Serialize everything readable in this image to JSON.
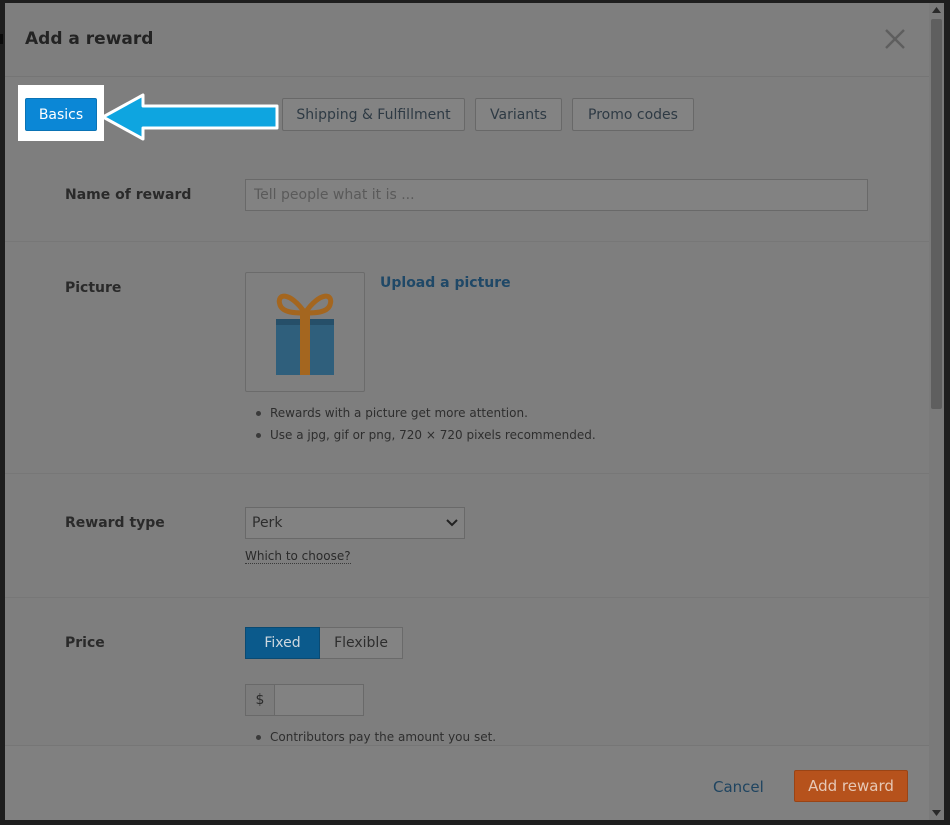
{
  "dialog": {
    "title": "Add a reward"
  },
  "tabs": [
    {
      "label": "Basics",
      "active": true
    },
    {
      "label": "Shipping & Fulfillment",
      "active": false
    },
    {
      "label": "Variants",
      "active": false
    },
    {
      "label": "Promo codes",
      "active": false
    }
  ],
  "form": {
    "name": {
      "label": "Name of reward",
      "placeholder": "Tell people what it is ...",
      "value": ""
    },
    "picture": {
      "label": "Picture",
      "upload_link": "Upload a picture",
      "icon": "gift-icon",
      "tips": [
        "Rewards with a picture get more attention.",
        "Use a jpg, gif or png, 720 × 720 pixels recommended."
      ]
    },
    "reward_type": {
      "label": "Reward type",
      "selected": "Perk",
      "help_link": "Which to choose?"
    },
    "price": {
      "label": "Price",
      "options": [
        "Fixed",
        "Flexible"
      ],
      "selected": "Fixed",
      "currency_symbol": "$",
      "value": "",
      "tips": [
        "Contributors pay the amount you set."
      ]
    }
  },
  "footer": {
    "cancel_label": "Cancel",
    "submit_label": "Add reward"
  },
  "colors": {
    "accent": "#0b87d6",
    "submit": "#b6521c",
    "arrow": "#0ea5e0"
  }
}
